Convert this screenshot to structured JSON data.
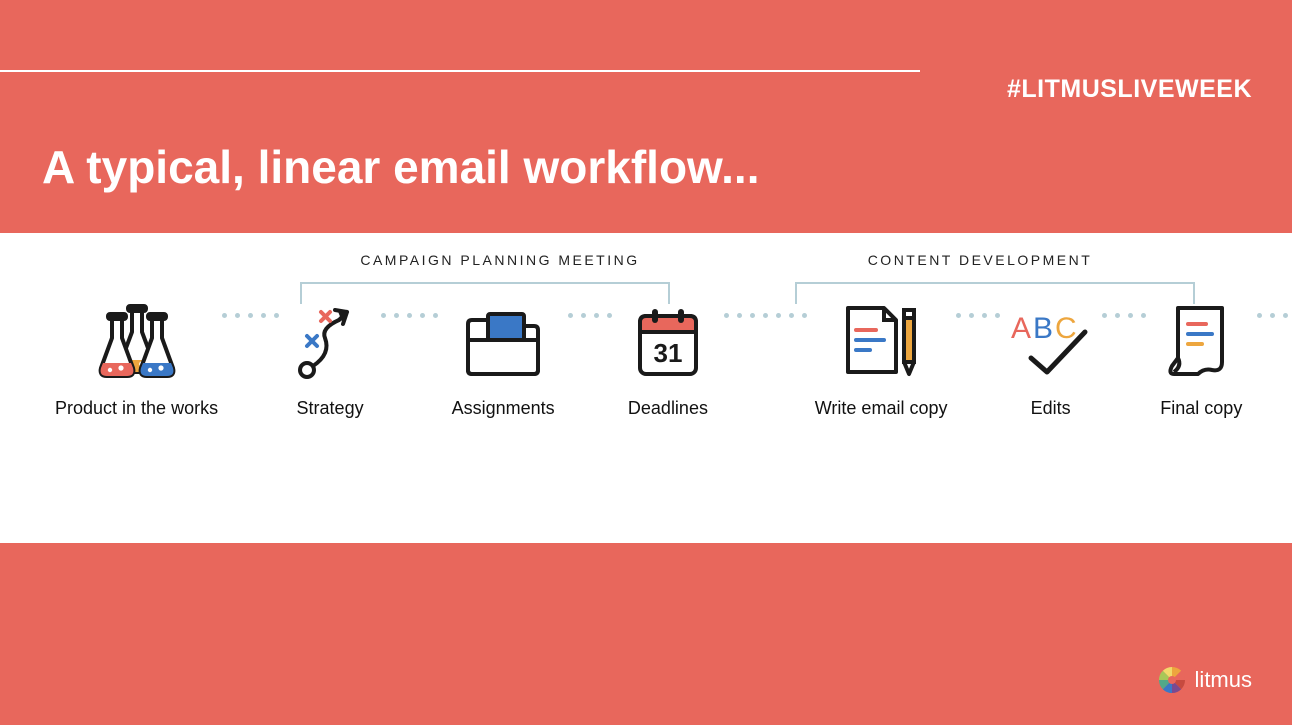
{
  "hashtag": "#LITMUSLIVEWEEK",
  "title": "A typical, linear email workflow...",
  "sections": {
    "planning": "CAMPAIGN PLANNING MEETING",
    "content": "CONTENT DEVELOPMENT"
  },
  "steps": [
    {
      "label": "Product in the works"
    },
    {
      "label": "Strategy"
    },
    {
      "label": "Assignments"
    },
    {
      "label": "Deadlines"
    },
    {
      "label": "Write email copy"
    },
    {
      "label": "Edits"
    },
    {
      "label": "Final copy"
    }
  ],
  "calendar_day": "31",
  "edits_text": "ABC",
  "brand": "litmus"
}
